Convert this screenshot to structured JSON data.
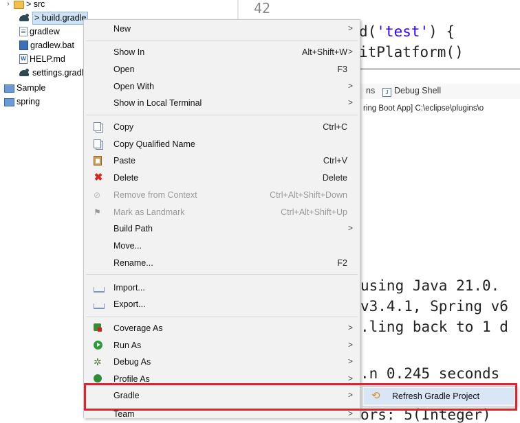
{
  "explorer": {
    "items": [
      {
        "label": "> src",
        "icon": "package-folder-icon"
      },
      {
        "label": "> build.gradle",
        "icon": "gradle-icon"
      },
      {
        "label": "gradlew",
        "icon": "file-icon"
      },
      {
        "label": "gradlew.bat",
        "icon": "batch-file-icon"
      },
      {
        "label": "HELP.md",
        "icon": "markdown-file-icon"
      },
      {
        "label": "settings.gradle",
        "icon": "gradle-icon"
      },
      {
        "label": "Sample",
        "icon": "project-folder-icon"
      },
      {
        "label": "spring",
        "icon": "project-folder-icon"
      }
    ]
  },
  "editor": {
    "line_number": "42",
    "line1_prefix": "d(",
    "line1_string": "'test'",
    "line1_suffix": ") {",
    "line2": "itPlatform()"
  },
  "views": {
    "tab_partial": "ns",
    "tab_debug_shell": "Debug Shell"
  },
  "console": {
    "header": "ring Boot App] C:\\eclipse\\plugins\\o",
    "lines": [
      "using Java 21.0.",
      "v3.4.1, Spring v6",
      ".ling back to 1 d",
      ".n 0.245 seconds",
      "ors: 5(Integer)"
    ]
  },
  "context_menu": {
    "groups": [
      [
        {
          "label": "New",
          "shortcut": "",
          "submenu": true,
          "icon": "",
          "disabled": false
        }
      ],
      [
        {
          "label": "Show In",
          "shortcut": "Alt+Shift+W",
          "submenu": true,
          "icon": "",
          "disabled": false
        },
        {
          "label": "Open",
          "shortcut": "F3",
          "submenu": false,
          "icon": "",
          "disabled": false
        },
        {
          "label": "Open With",
          "shortcut": "",
          "submenu": true,
          "icon": "",
          "disabled": false
        },
        {
          "label": "Show in Local Terminal",
          "shortcut": "",
          "submenu": true,
          "icon": "",
          "disabled": false
        }
      ],
      [
        {
          "label": "Copy",
          "shortcut": "Ctrl+C",
          "submenu": false,
          "icon": "copy-icon",
          "disabled": false
        },
        {
          "label": "Copy Qualified Name",
          "shortcut": "",
          "submenu": false,
          "icon": "copy-qualified-name-icon",
          "disabled": false
        },
        {
          "label": "Paste",
          "shortcut": "Ctrl+V",
          "submenu": false,
          "icon": "paste-icon",
          "disabled": false
        },
        {
          "label": "Delete",
          "shortcut": "Delete",
          "submenu": false,
          "icon": "delete-icon",
          "disabled": false
        },
        {
          "label": "Remove from Context",
          "shortcut": "Ctrl+Alt+Shift+Down",
          "submenu": false,
          "icon": "remove-context-icon",
          "disabled": true
        },
        {
          "label": "Mark as Landmark",
          "shortcut": "Ctrl+Alt+Shift+Up",
          "submenu": false,
          "icon": "landmark-icon",
          "disabled": true
        },
        {
          "label": "Build Path",
          "shortcut": "",
          "submenu": true,
          "icon": "",
          "disabled": false
        },
        {
          "label": "Move...",
          "shortcut": "",
          "submenu": false,
          "icon": "",
          "disabled": false
        },
        {
          "label": "Rename...",
          "shortcut": "F2",
          "submenu": false,
          "icon": "",
          "disabled": false
        }
      ],
      [
        {
          "label": "Import...",
          "shortcut": "",
          "submenu": false,
          "icon": "import-icon",
          "disabled": false
        },
        {
          "label": "Export...",
          "shortcut": "",
          "submenu": false,
          "icon": "export-icon",
          "disabled": false
        }
      ],
      [
        {
          "label": "Coverage As",
          "shortcut": "",
          "submenu": true,
          "icon": "coverage-icon",
          "disabled": false
        },
        {
          "label": "Run As",
          "shortcut": "",
          "submenu": true,
          "icon": "run-icon",
          "disabled": false
        },
        {
          "label": "Debug As",
          "shortcut": "",
          "submenu": true,
          "icon": "debug-icon",
          "disabled": false
        },
        {
          "label": "Profile As",
          "shortcut": "",
          "submenu": true,
          "icon": "profile-icon",
          "disabled": false
        },
        {
          "label": "Gradle",
          "shortcut": "",
          "submenu": true,
          "icon": "",
          "disabled": false
        },
        {
          "label": "Team",
          "shortcut": "",
          "submenu": true,
          "icon": "",
          "disabled": false
        }
      ]
    ],
    "submenu_arrow": ">"
  },
  "gradle_submenu": {
    "items": [
      {
        "label": "Refresh Gradle Project",
        "icon": "refresh-gradle-icon"
      }
    ]
  },
  "colors": {
    "highlight_border": "#e0222f",
    "menu_background": "#f2f2f2",
    "submenu_hover": "#d8e6f5"
  }
}
